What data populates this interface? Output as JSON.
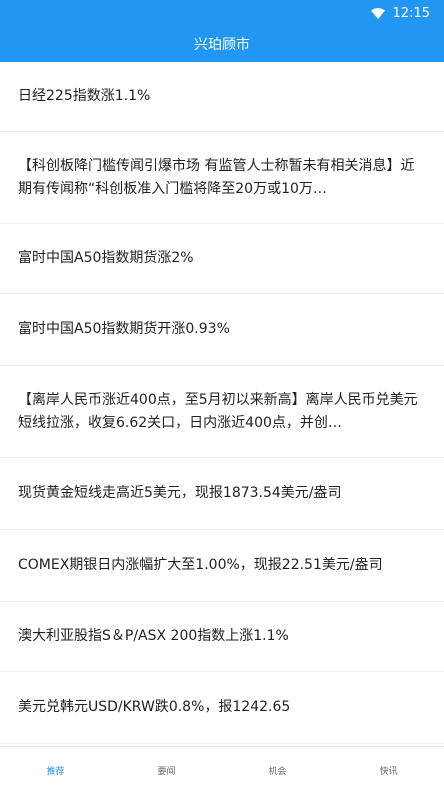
{
  "status_bar": {
    "time": "12:15",
    "wifi_icon": "wifi-icon"
  },
  "app_bar": {
    "title": "兴珀顾市"
  },
  "news": [
    {
      "text": "日经225指数涨1.1%"
    },
    {
      "text": "【科创板降门槛传闻引爆市场 有监管人士称暂未有相关消息】近期有传闻称“科创板准入门槛将降至20万或10万…"
    },
    {
      "text": "富时中国A50指数期货涨2%"
    },
    {
      "text": "富时中国A50指数期货开涨0.93%"
    },
    {
      "text": "【离岸人民币涨近400点，至5月初以来新高】离岸人民币兑美元短线拉涨，收复6.62关口，日内涨近400点，并创…"
    },
    {
      "text": "现货黄金短线走高近5美元，现报1873.54美元/盎司"
    },
    {
      "text": "COMEX期银日内涨幅扩大至1.00%，现报22.51美元/盎司"
    },
    {
      "text": "澳大利亚股指S＆P/ASX 200指数上涨1.1%"
    },
    {
      "text": "美元兑韩元USD/KRW跌0.8%，报1242.65"
    }
  ],
  "tabs": [
    {
      "label": "推荐",
      "active": true
    },
    {
      "label": "要闻",
      "active": false
    },
    {
      "label": "机会",
      "active": false
    },
    {
      "label": "快讯",
      "active": false
    }
  ],
  "colors": {
    "primary": "#2196f3",
    "text": "#222222",
    "tab_inactive": "#666666"
  }
}
